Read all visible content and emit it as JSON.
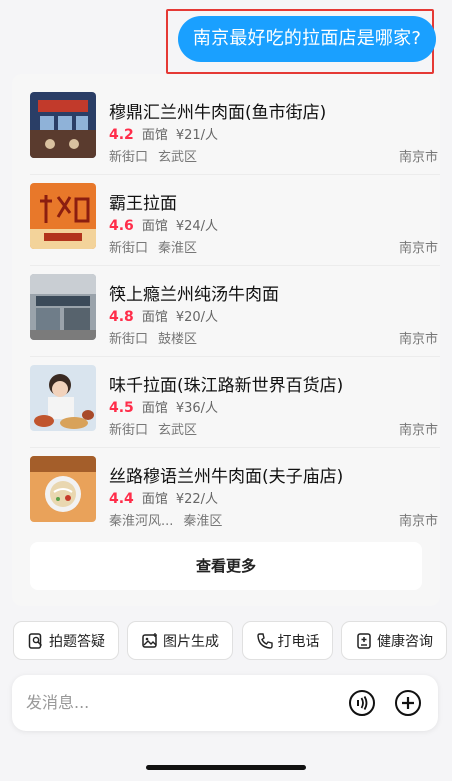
{
  "user_query": "南京最好吃的拉面店是哪家?",
  "results": [
    {
      "name": "穆鼎汇兰州牛肉面(鱼市街店)",
      "rating": "4.2",
      "category": "面馆",
      "price": "¥21/人",
      "area": "新街口",
      "district": "玄武区",
      "city": "南京市"
    },
    {
      "name": "霸王拉面",
      "rating": "4.6",
      "category": "面馆",
      "price": "¥24/人",
      "area": "新街口",
      "district": "秦淮区",
      "city": "南京市"
    },
    {
      "name": "筷上瘾兰州纯汤牛肉面",
      "rating": "4.8",
      "category": "面馆",
      "price": "¥20/人",
      "area": "新街口",
      "district": "鼓楼区",
      "city": "南京市"
    },
    {
      "name": "味千拉面(珠江路新世界百货店)",
      "rating": "4.5",
      "category": "面馆",
      "price": "¥36/人",
      "area": "新街口",
      "district": "玄武区",
      "city": "南京市"
    },
    {
      "name": "丝路穆语兰州牛肉面(夫子庙店)",
      "rating": "4.4",
      "category": "面馆",
      "price": "¥22/人",
      "area": "秦淮河风...",
      "district": "秦淮区",
      "city": "南京市"
    }
  ],
  "more_label": "查看更多",
  "quick_actions": [
    "拍题答疑",
    "图片生成",
    "打电话",
    "健康咨询"
  ],
  "input": {
    "placeholder": "发消息..."
  },
  "colors": {
    "bubble": "#1aa0ff",
    "rating": "#ff2d4a",
    "highlight": "#e53935"
  }
}
